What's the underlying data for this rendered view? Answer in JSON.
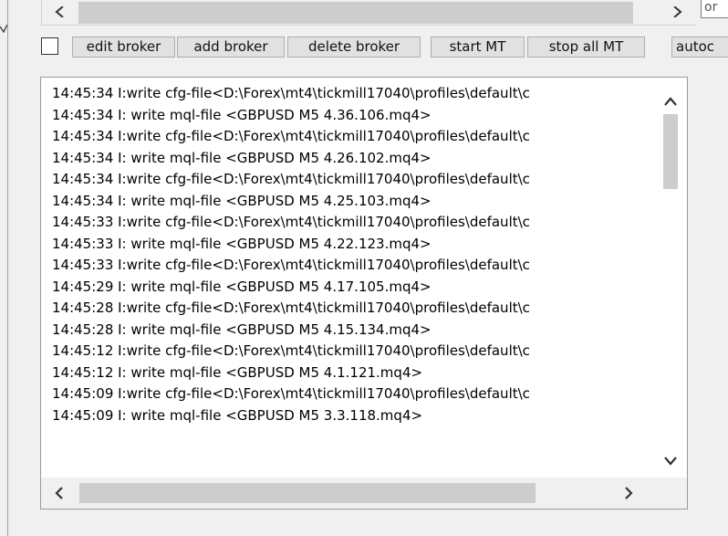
{
  "top_right_field": {
    "value": "or"
  },
  "toolbar": {
    "checkbox_checked": false,
    "edit_broker": "edit broker",
    "add_broker": "add broker",
    "delete_broker": "delete broker",
    "start_mt": "start MT",
    "stop_all_mt": "stop all MT",
    "autoc": "autoc"
  },
  "log": {
    "lines": [
      "14:45:34 I:write cfg-file<D:\\Forex\\mt4\\tickmill17040\\profiles\\default\\c",
      "14:45:34 I: write mql-file <GBPUSD M5 4.36.106.mq4>",
      "14:45:34 I:write cfg-file<D:\\Forex\\mt4\\tickmill17040\\profiles\\default\\c",
      "14:45:34 I: write mql-file <GBPUSD M5 4.26.102.mq4>",
      "14:45:34 I:write cfg-file<D:\\Forex\\mt4\\tickmill17040\\profiles\\default\\c",
      "14:45:34 I: write mql-file <GBPUSD M5 4.25.103.mq4>",
      "14:45:33 I:write cfg-file<D:\\Forex\\mt4\\tickmill17040\\profiles\\default\\c",
      "14:45:33 I: write mql-file <GBPUSD M5 4.22.123.mq4>",
      "14:45:33 I:write cfg-file<D:\\Forex\\mt4\\tickmill17040\\profiles\\default\\c",
      "14:45:29 I: write mql-file <GBPUSD M5 4.17.105.mq4>",
      "14:45:28 I:write cfg-file<D:\\Forex\\mt4\\tickmill17040\\profiles\\default\\c",
      "14:45:28 I: write mql-file <GBPUSD M5 4.15.134.mq4>",
      "14:45:12 I:write cfg-file<D:\\Forex\\mt4\\tickmill17040\\profiles\\default\\c",
      "14:45:12 I: write mql-file <GBPUSD M5 4.1.121.mq4>",
      "14:45:09 I:write cfg-file<D:\\Forex\\mt4\\tickmill17040\\profiles\\default\\c",
      "14:45:09 I: write mql-file <GBPUSD M5 3.3.118.mq4>"
    ]
  },
  "icons": {
    "scroll_left": "chevron-left-icon",
    "scroll_right": "chevron-right-icon",
    "scroll_up": "chevron-up-icon",
    "scroll_down": "chevron-down-icon"
  }
}
